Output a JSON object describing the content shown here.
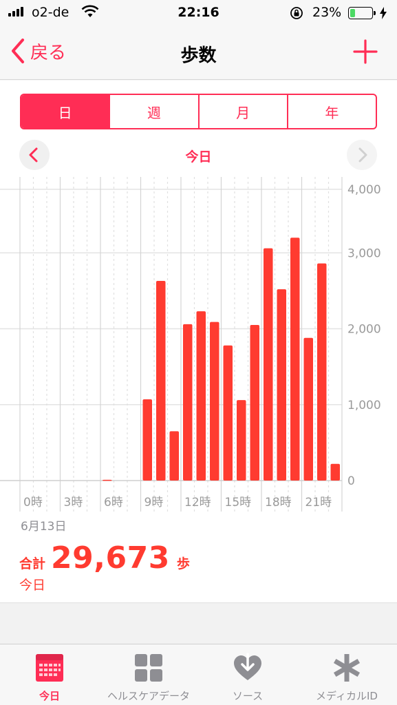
{
  "status_bar": {
    "carrier": "o2-de",
    "time": "22:16",
    "battery_percent": "23%",
    "battery_level": 0.23,
    "signal_bars": 4
  },
  "nav": {
    "back_label": "戻る",
    "title": "歩数",
    "add_icon": "plus-icon"
  },
  "segments": [
    {
      "label": "日",
      "active": true
    },
    {
      "label": "週",
      "active": false
    },
    {
      "label": "月",
      "active": false
    },
    {
      "label": "年",
      "active": false
    }
  ],
  "date_nav": {
    "label": "今日"
  },
  "chart_data": {
    "type": "bar",
    "x": [
      0,
      1,
      2,
      3,
      4,
      5,
      6,
      7,
      8,
      9,
      10,
      11,
      12,
      13,
      14,
      15,
      16,
      17,
      18,
      19,
      20,
      21,
      22,
      23
    ],
    "values": [
      0,
      0,
      0,
      0,
      0,
      0,
      10,
      0,
      0,
      1070,
      2630,
      650,
      2060,
      2230,
      2090,
      1780,
      1060,
      2050,
      3060,
      2520,
      3200,
      1880,
      2860,
      220
    ],
    "tick_labels": [
      "0時",
      "3時",
      "6時",
      "9時",
      "12時",
      "15時",
      "18時",
      "21時"
    ],
    "tick_hours": [
      0,
      3,
      6,
      9,
      12,
      15,
      18,
      21
    ],
    "y_ticks": [
      0,
      1000,
      2000,
      3000,
      4000
    ],
    "y_tick_labels": [
      "0",
      "1,000",
      "2,000",
      "3,000",
      "4,000"
    ],
    "ylim": [
      0,
      4000
    ],
    "bar_color": "#ff3b30",
    "grid": true
  },
  "summary": {
    "date": "6月13日",
    "label": "合計",
    "value": "29,673",
    "unit": "歩",
    "period": "今日"
  },
  "tabs": [
    {
      "label": "今日",
      "icon": "calendar-icon",
      "active": true
    },
    {
      "label": "ヘルスケアデータ",
      "icon": "grid-icon",
      "active": false
    },
    {
      "label": "ソース",
      "icon": "heart-download-icon",
      "active": false
    },
    {
      "label": "メディカルID",
      "icon": "asterisk-icon",
      "active": false
    }
  ],
  "colors": {
    "accent": "#ff2d55",
    "bar": "#ff3b30",
    "inactive_tab": "#8e8e93"
  }
}
